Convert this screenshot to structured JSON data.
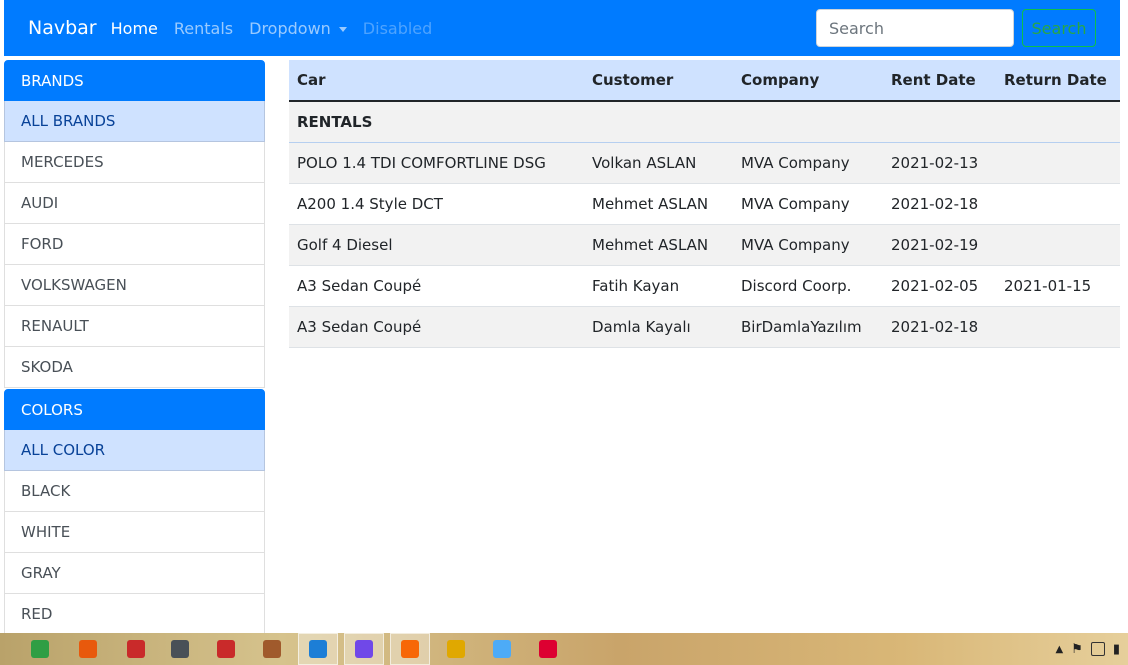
{
  "navbar": {
    "brand": "Navbar",
    "links": [
      {
        "label": "Home",
        "state": "active"
      },
      {
        "label": "Rentals",
        "state": "normal"
      },
      {
        "label": "Dropdown",
        "state": "dropdown"
      },
      {
        "label": "Disabled",
        "state": "disabled"
      }
    ],
    "search_placeholder": "Search",
    "search_button": "Search"
  },
  "brands": {
    "header": "BRANDS",
    "items": [
      "ALL BRANDS",
      "MERCEDES",
      "AUDI",
      "FORD",
      "VOLKSWAGEN",
      "RENAULT",
      "SKODA"
    ]
  },
  "colors": {
    "header": "COLORS",
    "items": [
      "ALL COLOR",
      "BLACK",
      "WHITE",
      "GRAY",
      "RED"
    ]
  },
  "rentals": {
    "title": "RENTALS",
    "columns": [
      "Car",
      "Customer",
      "Company",
      "Rent Date",
      "Return Date"
    ],
    "rows": [
      [
        "POLO 1.4 TDI COMFORTLINE DSG",
        "Volkan ASLAN",
        "MVA Company",
        "2021-02-13",
        ""
      ],
      [
        "A200 1.4 Style DCT",
        "Mehmet ASLAN",
        "MVA Company",
        "2021-02-18",
        ""
      ],
      [
        "Golf 4 Diesel",
        "Mehmet ASLAN",
        "MVA Company",
        "2021-02-19",
        ""
      ],
      [
        "A3 Sedan Coupé",
        "Fatih Kayan",
        "Discord Coorp.",
        "2021-02-05",
        "2021-01-15"
      ],
      [
        "A3 Sedan Coupé",
        "Damla Kayalı",
        "BirDamlaYazılım",
        "2021-02-18",
        ""
      ]
    ]
  },
  "taskbar": {
    "icons": [
      "chrome-icon",
      "firefox-icon",
      "acrobat-icon",
      "spy-icon",
      "filezilla-icon",
      "paint-icon",
      "vscode-icon",
      "visual-studio-icon",
      "postman-icon",
      "folder-icon",
      "photos-icon",
      "angular-icon"
    ],
    "icon_colors": [
      "#2f9e44",
      "#e8590c",
      "#c92a2a",
      "#495057",
      "#c92a2a",
      "#a05a2c",
      "#1c7ed6",
      "#7048e8",
      "#f76707",
      "#e0a800",
      "#4dabf7",
      "#dd0031"
    ]
  },
  "colors_theme": {
    "primary": "#007bff",
    "selected_bg": "#cfe2ff",
    "success": "#28a745"
  }
}
